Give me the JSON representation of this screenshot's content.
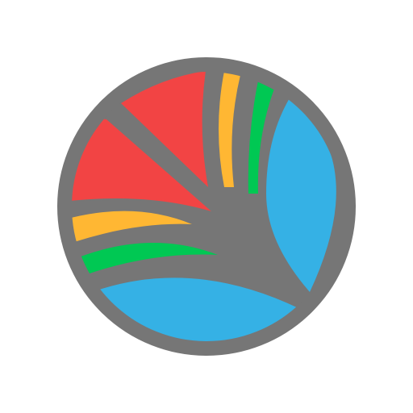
{
  "icon": {
    "name": "circular-color-fan-logo",
    "colors": {
      "outline": "#767676",
      "red": "#F24444",
      "yellow": "#FFB733",
      "green": "#00C853",
      "blue": "#35B1E5",
      "background": "#FFFFFF"
    }
  }
}
